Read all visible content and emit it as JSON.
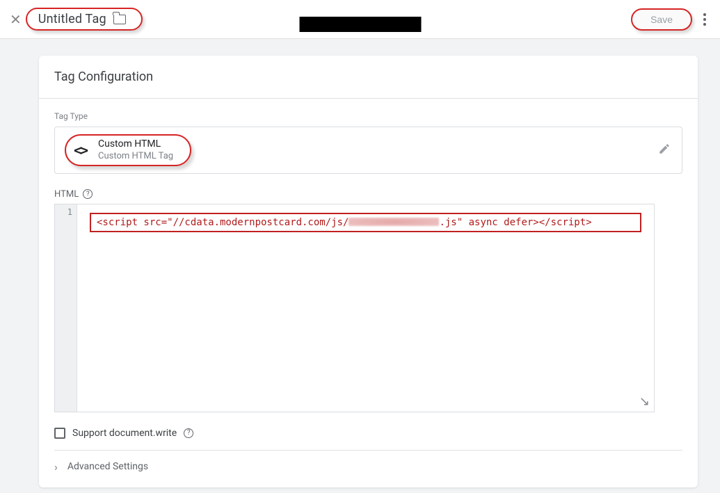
{
  "header": {
    "title": "Untitled Tag",
    "save_label": "Save"
  },
  "card": {
    "title": "Tag Configuration",
    "tag_type_label": "Tag Type",
    "type_name": "Custom HTML",
    "type_sub": "Custom HTML Tag",
    "html_label": "HTML",
    "line_number": "1",
    "code_prefix": "<script src=\"//cdata.modernpostcard.com/js/",
    "code_suffix": ".js\" async defer></script>",
    "support_label": "Support document.write",
    "advanced_label": "Advanced Settings"
  }
}
